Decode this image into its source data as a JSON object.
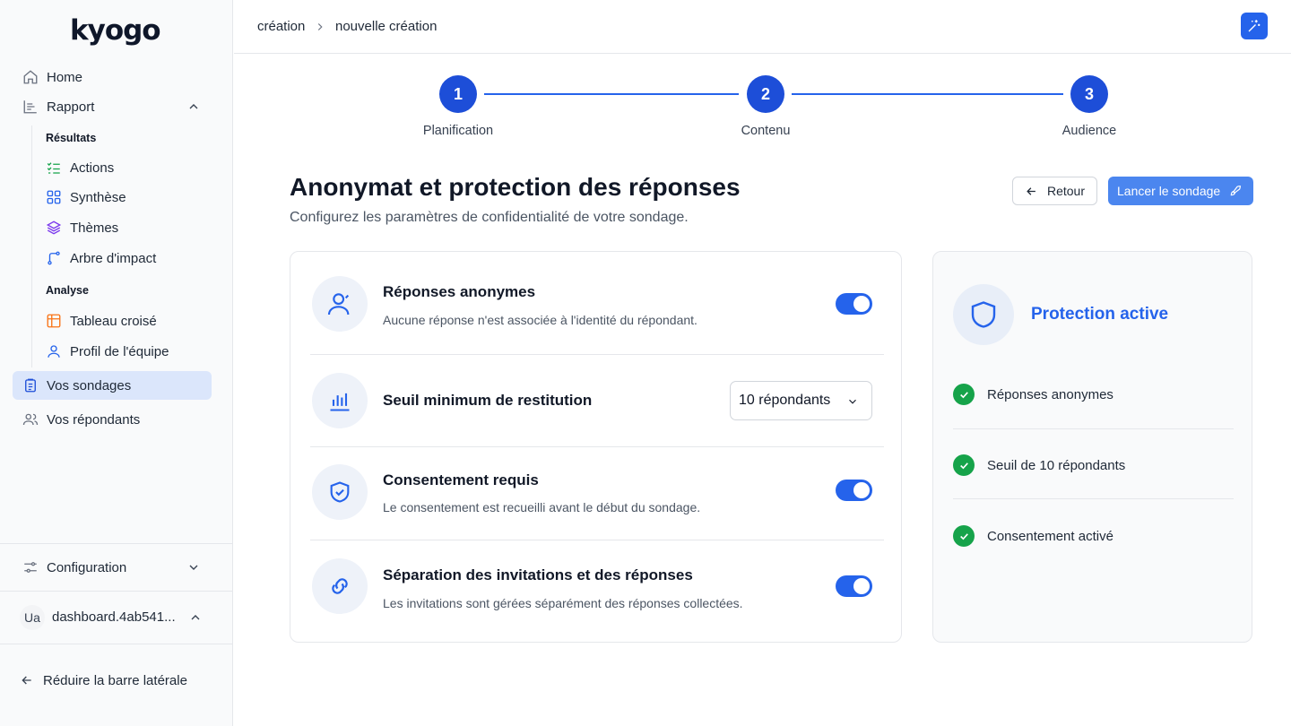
{
  "sidebar": {
    "logo": "kyogo",
    "home": "Home",
    "rapport": "Rapport",
    "resultats_heading": "Résultats",
    "actions": "Actions",
    "synthese": "Synthèse",
    "themes": "Thèmes",
    "arbre": "Arbre d'impact",
    "analyse_heading": "Analyse",
    "tableau": "Tableau croisé",
    "profil": "Profil de l'équipe",
    "sondages": "Vos sondages",
    "repondants": "Vos répondants",
    "configuration": "Configuration",
    "user_initials": "Ua",
    "user_name": "dashboard.4ab541...",
    "collapse": "Réduire la barre latérale"
  },
  "breadcrumb": {
    "parent": "création",
    "current": "nouvelle création"
  },
  "stepper": [
    {
      "number": "1",
      "label": "Planification"
    },
    {
      "number": "2",
      "label": "Contenu"
    },
    {
      "number": "3",
      "label": "Audience"
    }
  ],
  "page": {
    "title": "Anonymat et protection des réponses",
    "subtitle": "Configurez les paramètres de confidentialité de votre sondage.",
    "back_label": "Retour",
    "launch_label": "Lancer le sondage"
  },
  "settings": {
    "anonymous": {
      "title": "Réponses anonymes",
      "desc": "Aucune réponse n'est associée à l'identité du répondant.",
      "enabled": true
    },
    "threshold": {
      "title": "Seuil minimum de restitution",
      "value": "10 répondants"
    },
    "consent": {
      "title": "Consentement requis",
      "desc": "Le consentement est recueilli avant le début du sondage.",
      "enabled": true
    },
    "separation": {
      "title": "Séparation des invitations et des réponses",
      "desc": "Les invitations sont gérées séparément des réponses collectées.",
      "enabled": true
    }
  },
  "summary": {
    "title": "Protection active",
    "items": [
      "Réponses anonymes",
      "Seuil de 10 répondants",
      "Consentement activé"
    ]
  },
  "colors": {
    "accent": "#2563eb",
    "success": "#16a34a",
    "active_nav": "#dbe6fb"
  }
}
